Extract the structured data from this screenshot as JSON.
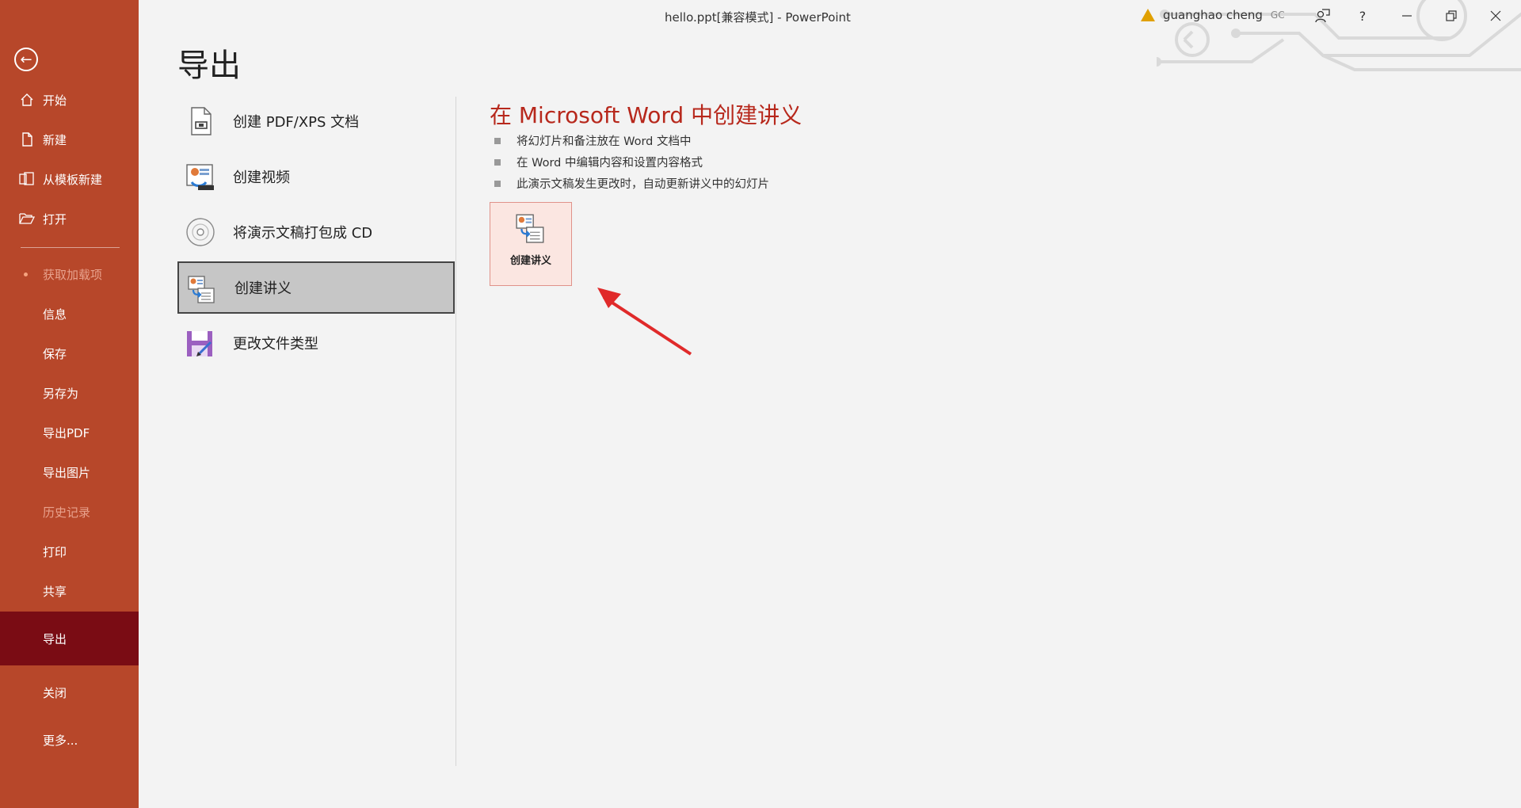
{
  "window": {
    "title": "hello.ppt[兼容模式]  -  PowerPoint",
    "user_name": "guanghao cheng",
    "user_initials": "GC",
    "help_label": "?"
  },
  "sidebar": {
    "items": [
      {
        "label": "开始",
        "icon": "home-icon"
      },
      {
        "label": "新建",
        "icon": "new-doc-icon"
      },
      {
        "label": "从模板新建",
        "icon": "template-icon"
      },
      {
        "label": "打开",
        "icon": "folder-open-icon"
      },
      {
        "label": "获取加载项",
        "icon": "dot"
      },
      {
        "label": "信息"
      },
      {
        "label": "保存"
      },
      {
        "label": "另存为"
      },
      {
        "label": "导出PDF"
      },
      {
        "label": "导出图片"
      },
      {
        "label": "历史记录"
      },
      {
        "label": "打印"
      },
      {
        "label": "共享"
      },
      {
        "label": "导出"
      },
      {
        "label": "关闭"
      },
      {
        "label": "更多..."
      }
    ],
    "active": "导出"
  },
  "main": {
    "page_title": "导出",
    "options": [
      {
        "label": "创建 PDF/XPS 文档",
        "icon": "pdf-doc-icon"
      },
      {
        "label": "创建视频",
        "icon": "video-icon"
      },
      {
        "label": "将演示文稿打包成 CD",
        "icon": "cd-icon"
      },
      {
        "label": "创建讲义",
        "icon": "handout-icon"
      },
      {
        "label": "更改文件类型",
        "icon": "change-file-type-icon"
      }
    ],
    "selected_option": "创建讲义",
    "detail": {
      "title": "在 Microsoft Word 中创建讲义",
      "bullets": [
        "将幻灯片和备注放在 Word 文档中",
        "在 Word 中编辑内容和设置内容格式",
        "此演示文稿发生更改时，自动更新讲义中的幻灯片"
      ],
      "button_label": "创建讲义"
    }
  },
  "colors": {
    "sidebar_bg": "#b7472a",
    "sidebar_active": "#7a0c14",
    "accent_title": "#b7281c"
  }
}
